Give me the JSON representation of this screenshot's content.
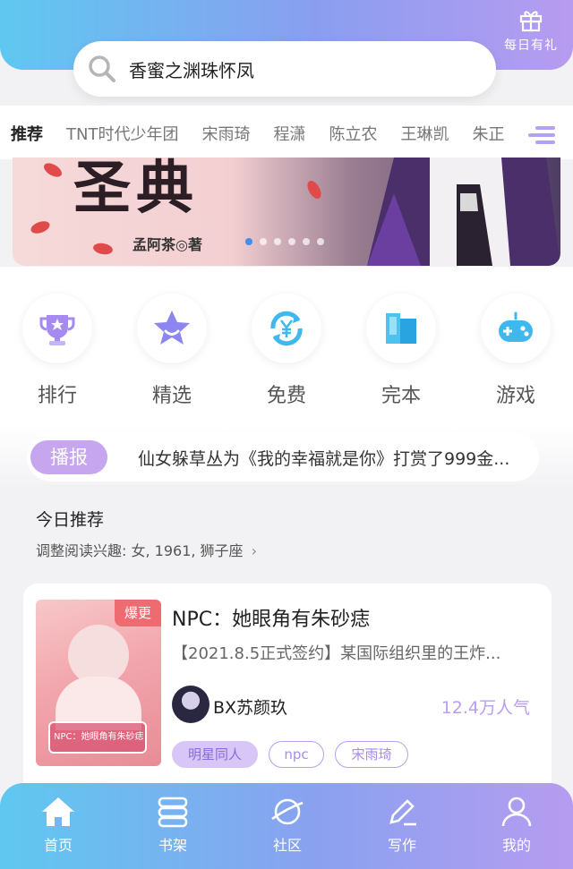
{
  "header": {
    "gift_label": "每日有礼"
  },
  "search": {
    "query": "香蜜之渊珠怀凤"
  },
  "tabs": [
    {
      "label": "推荐",
      "active": true
    },
    {
      "label": "TNT时代少年团"
    },
    {
      "label": "宋雨琦"
    },
    {
      "label": "程潇"
    },
    {
      "label": "陈立农"
    },
    {
      "label": "王琳凯"
    },
    {
      "label": "朱正"
    }
  ],
  "banner": {
    "title": "圣典",
    "author": "孟阿茶◎著",
    "dots_total": 6,
    "dot_active": 0
  },
  "quick_entries": [
    {
      "label": "排行",
      "icon": "trophy-icon"
    },
    {
      "label": "精选",
      "icon": "star-icon"
    },
    {
      "label": "免费",
      "icon": "yen-icon"
    },
    {
      "label": "完本",
      "icon": "book-icon"
    },
    {
      "label": "游戏",
      "icon": "gamepad-icon"
    }
  ],
  "broadcast": {
    "badge": "播报",
    "text": "仙女躲草丛为《我的幸福就是你》打赏了999金..."
  },
  "section": {
    "title": "今日推荐",
    "prefs": "调整阅读兴趣: 女, 1961, 狮子座"
  },
  "book": {
    "badge": "爆更",
    "title": "NPC：她眼角有朱砂痣",
    "desc": "【2021.8.5正式签约】某国际组织里的王炸...",
    "author": "BX苏颜玖",
    "popularity": "12.4万人气",
    "tags": [
      "明星同人",
      "npc",
      "宋雨琦"
    ]
  },
  "bottom_nav": [
    {
      "label": "首页",
      "icon": "home-icon"
    },
    {
      "label": "书架",
      "icon": "bookshelf-icon"
    },
    {
      "label": "社区",
      "icon": "planet-icon"
    },
    {
      "label": "写作",
      "icon": "pen-icon"
    },
    {
      "label": "我的",
      "icon": "user-icon"
    }
  ],
  "colors": {
    "accent": "#b79ff0",
    "brand_start": "#5fc8f0",
    "hot": "#ef6b72"
  }
}
